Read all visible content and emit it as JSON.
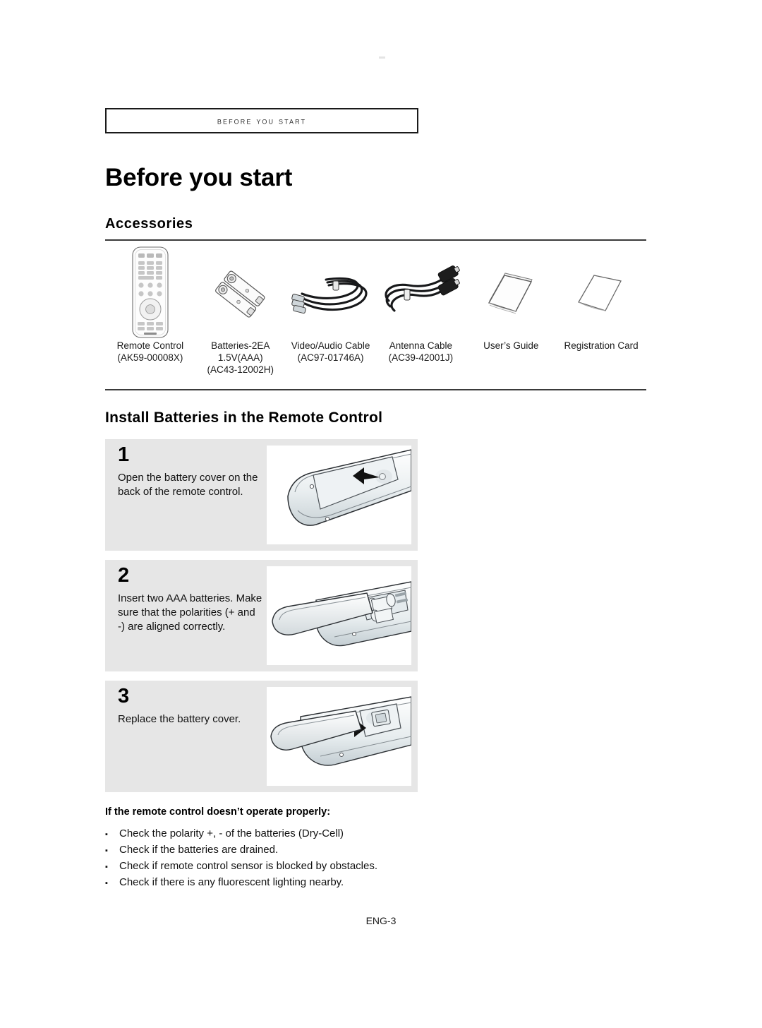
{
  "header": {
    "running_head": "Before you start"
  },
  "page_title": "Before you start",
  "accessories": {
    "section_title": "Accessories",
    "items": [
      {
        "icon": "remote-control-icon",
        "name": "Remote Control",
        "code": "(AK59-00008X)",
        "code2": ""
      },
      {
        "icon": "batteries-icon",
        "name": "Batteries-2EA",
        "code": "1.5V(AAA)",
        "code2": "(AC43-12002H)"
      },
      {
        "icon": "video-audio-cable-icon",
        "name": "Video/Audio Cable",
        "code": "(AC97-01746A)",
        "code2": ""
      },
      {
        "icon": "antenna-cable-icon",
        "name": "Antenna Cable",
        "code": "(AC39-42001J)",
        "code2": ""
      },
      {
        "icon": "users-guide-icon",
        "name": "User’s Guide",
        "code": "",
        "code2": ""
      },
      {
        "icon": "registration-card-icon",
        "name": "Registration Card",
        "code": "",
        "code2": ""
      }
    ]
  },
  "install": {
    "section_title": "Install Batteries in the Remote Control",
    "steps": [
      {
        "number": "1",
        "text": "Open the battery cover on the back of the remote control.",
        "illustration": "remote-back-cover-closed-with-arrow"
      },
      {
        "number": "2",
        "text": "Insert two AAA batteries. Make sure that the polarities (+ and -) are aligned correctly.",
        "illustration": "remote-battery-compartment-open"
      },
      {
        "number": "3",
        "text": "Replace the battery cover.",
        "illustration": "remote-cover-replace-with-arrow"
      }
    ]
  },
  "troubleshooting": {
    "title": "If the remote control doesn’t operate properly:",
    "bullet_glyph": "▪",
    "items": [
      "Check the polarity +, - of the batteries (Dry-Cell)",
      "Check if the batteries are drained.",
      "Check if remote control sensor is blocked by obstacles.",
      "Check if there is any fluorescent lighting nearby."
    ]
  },
  "footer": {
    "page_label": "ENG-3"
  },
  "colors": {
    "panel_gray": "#e6e6e6",
    "rule": "#3a3a3a",
    "text": "#111111"
  }
}
